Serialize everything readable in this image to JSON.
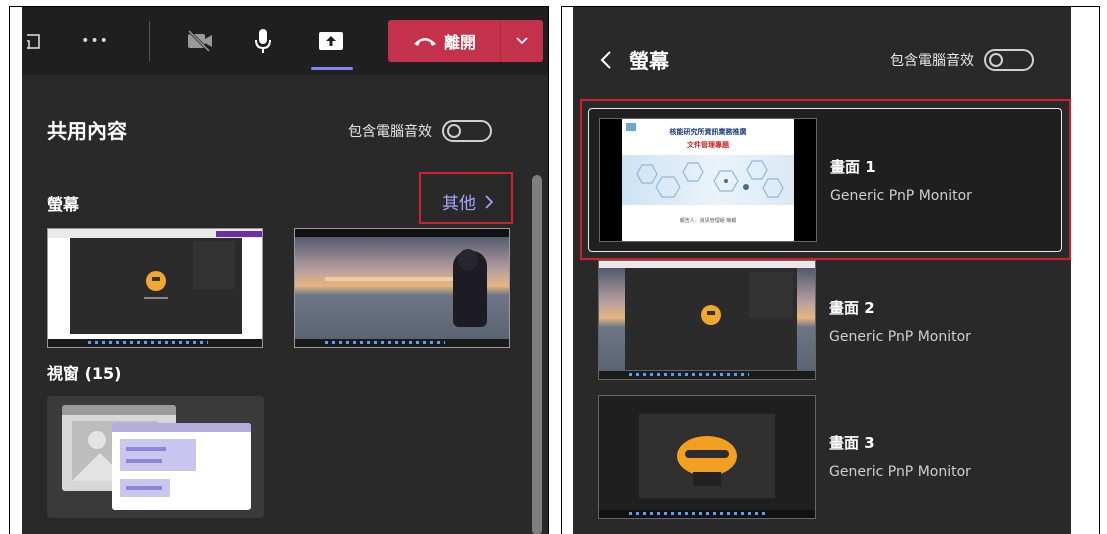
{
  "left": {
    "toolbar": {
      "more_label": "•••",
      "leave_label": "離開"
    },
    "title": "共用內容",
    "include_audio_label": "包含電腦音效",
    "screens_label": "螢幕",
    "more_link": "其他",
    "windows_label": "視窗 (15)"
  },
  "right": {
    "back_title": "螢幕",
    "include_audio_label": "包含電腦音效",
    "monitors": [
      {
        "name": "畫面 1",
        "sub": "Generic PnP Monitor"
      },
      {
        "name": "畫面 2",
        "sub": "Generic PnP Monitor"
      },
      {
        "name": "畫面 3",
        "sub": "Generic PnP Monitor"
      }
    ],
    "slide": {
      "title": "核能研究所資訊業務推廣",
      "subtitle": "文件管理專題",
      "footer": "報告人：資訊管理組 簡報"
    }
  },
  "colors": {
    "panel_bg": "#292929",
    "toolbar_bg": "#1f1f1f",
    "leave_red": "#c4314b",
    "link_purple": "#a6a3ff",
    "highlight_red": "#d0202e"
  }
}
